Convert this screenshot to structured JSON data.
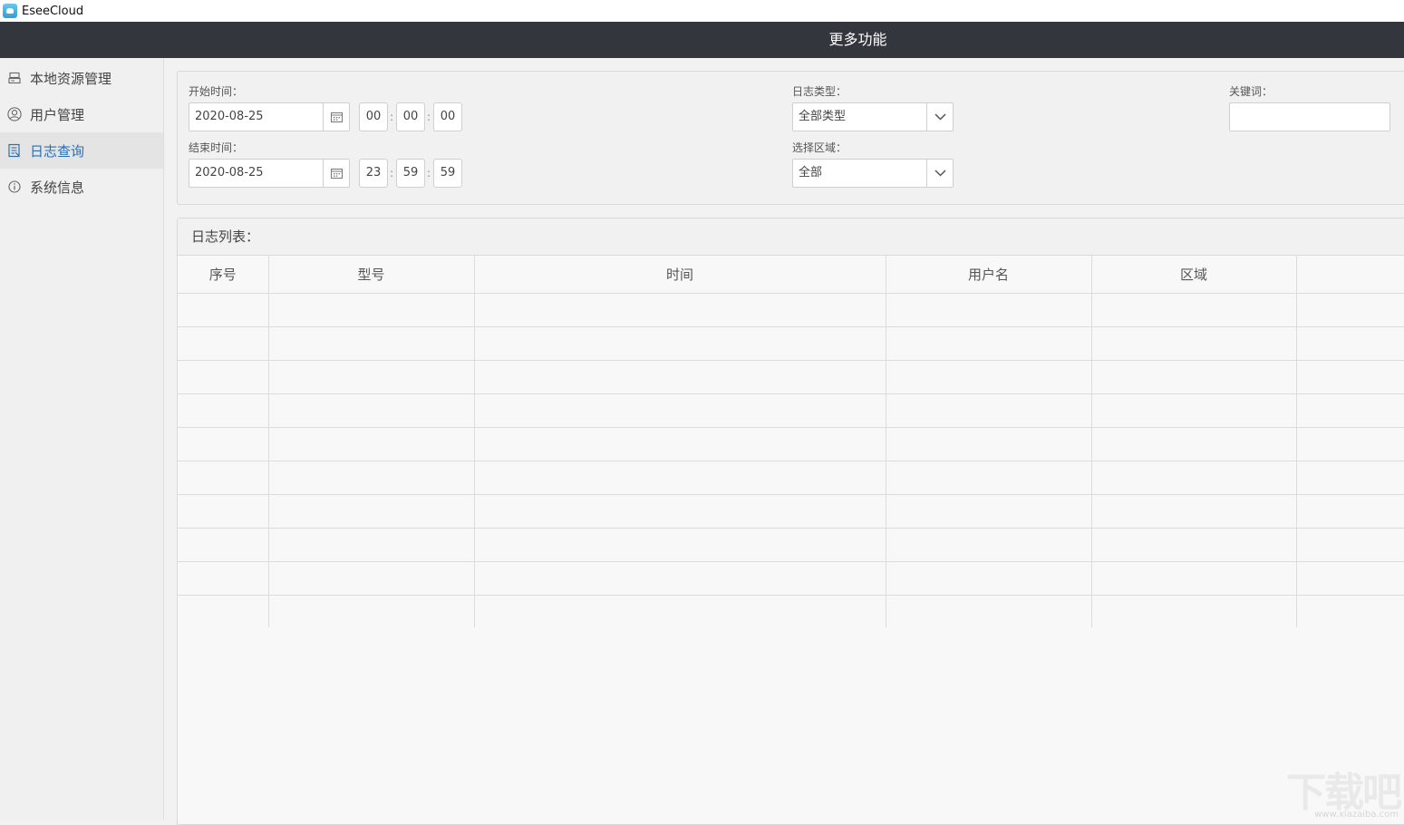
{
  "app": {
    "title": "EseeCloud"
  },
  "header": {
    "title": "更多功能"
  },
  "sidebar": {
    "items": [
      {
        "label": "本地资源管理",
        "icon": "storage-icon",
        "active": false
      },
      {
        "label": "用户管理",
        "icon": "user-icon",
        "active": false
      },
      {
        "label": "日志查询",
        "icon": "log-icon",
        "active": true
      },
      {
        "label": "系统信息",
        "icon": "info-icon",
        "active": false
      }
    ]
  },
  "filters": {
    "start_label": "开始时间：",
    "start_date": "2020-08-25",
    "start_hour": "00",
    "start_minute": "00",
    "start_second": "00",
    "end_label": "结束时间：",
    "end_date": "2020-08-25",
    "end_hour": "23",
    "end_minute": "59",
    "end_second": "59",
    "time_separator": ":",
    "log_type_label": "日志类型：",
    "log_type_value": "全部类型",
    "region_label": "选择区域：",
    "region_value": "全部",
    "keyword_label": "关键词：",
    "keyword_value": ""
  },
  "log_list": {
    "title": "日志列表：",
    "columns": [
      "序号",
      "型号",
      "时间",
      "用户名",
      "区域",
      ""
    ],
    "rows": []
  },
  "watermark": {
    "text": "下载吧",
    "sub": "www.xiazaiba.com"
  },
  "colors": {
    "header_bg": "#33363d",
    "active_text": "#2a6fb5",
    "app_icon": "#2f9fd6"
  }
}
